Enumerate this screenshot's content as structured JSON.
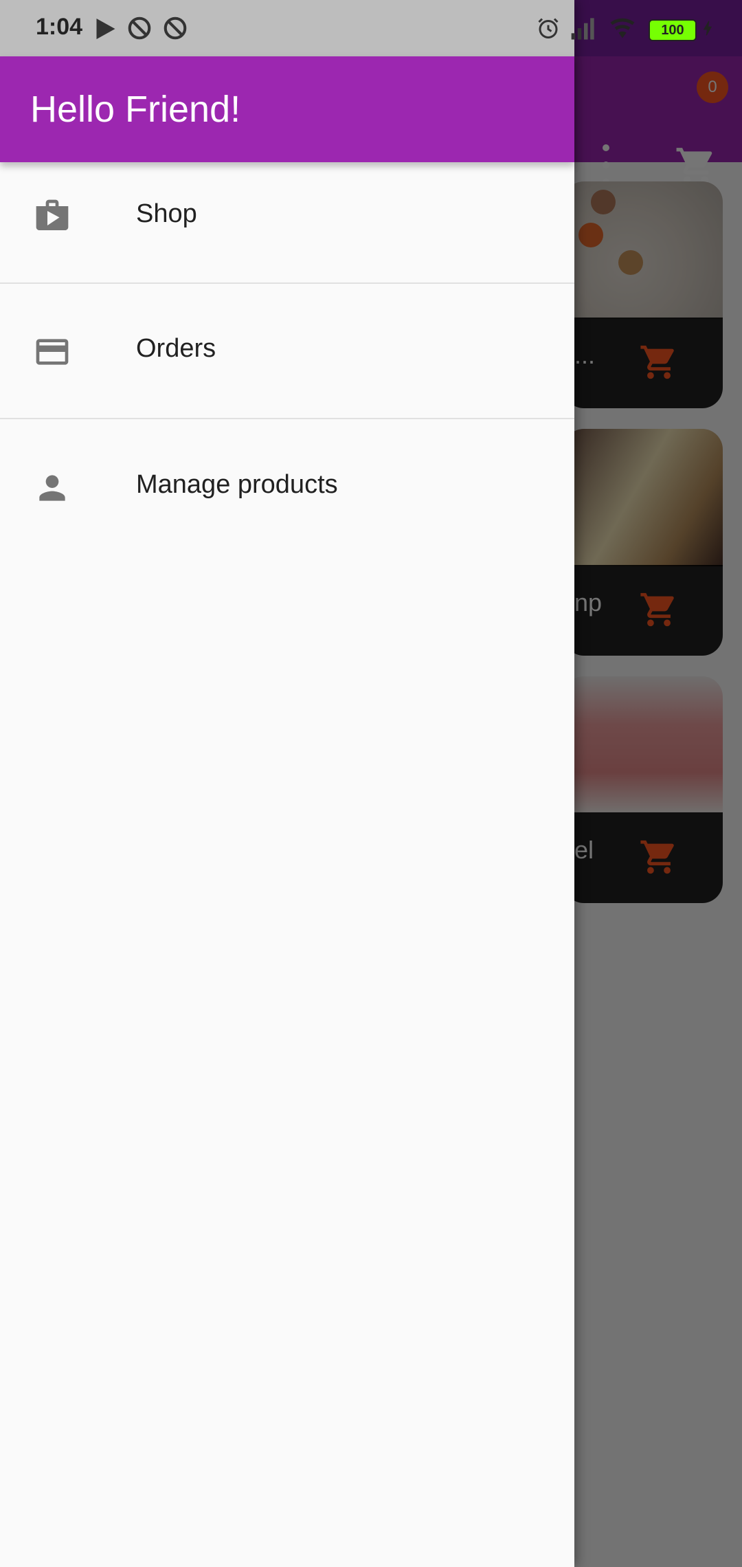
{
  "status_bar": {
    "time": "1:04",
    "battery": "100",
    "icons": [
      "play-store-icon",
      "no-disturb-icon",
      "no-disturb-icon",
      "alarm-icon",
      "signal-icon",
      "wifi-icon",
      "battery-icon",
      "charging-icon"
    ]
  },
  "drawer": {
    "title": "Hello Friend!",
    "items": [
      {
        "label": "Shop",
        "icon": "shop-icon"
      },
      {
        "label": "Orders",
        "icon": "credit-card-icon"
      },
      {
        "label": "Manage products",
        "icon": "person-icon"
      }
    ]
  },
  "background_app": {
    "cart_badge": "0",
    "products": [
      {
        "title_fragment": "..."
      },
      {
        "title_fragment": "np"
      },
      {
        "title_fragment": "el"
      }
    ]
  },
  "colors": {
    "primary": "#9c27b0",
    "primary_dark": "#7b1fa2",
    "accent": "#ff5722",
    "drawer_bg": "#fafafa",
    "icon_grey": "#757575"
  }
}
